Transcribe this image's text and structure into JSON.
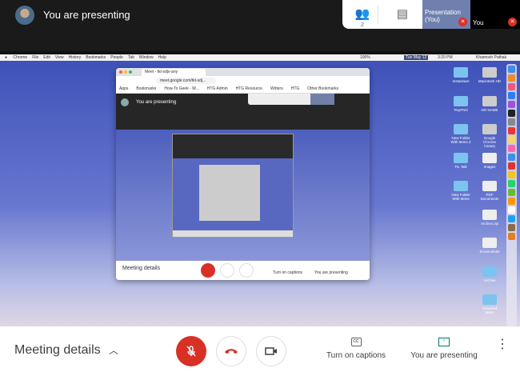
{
  "header": {
    "title": "You are presenting",
    "participant_count": "2"
  },
  "tiles": [
    {
      "label": "Presentation (You)"
    },
    {
      "label": "You"
    }
  ],
  "menubar": {
    "items": [
      "Chrome",
      "File",
      "Edit",
      "View",
      "History",
      "Bookmarks",
      "People",
      "Tab",
      "Window",
      "Help"
    ],
    "date": "Tue May 12",
    "time": "3:20 PM",
    "user": "Khamosh Pathak",
    "battery": "100%"
  },
  "desktop_icons": [
    {
      "label": "Instashare",
      "type": "folder"
    },
    {
      "label": "Macintosh HD",
      "type": "drive"
    },
    {
      "label": "TinyPNG",
      "type": "folder"
    },
    {
      "label": "NO NAME",
      "type": "drive"
    },
    {
      "label": "New Folder With Items 2",
      "type": "folder"
    },
    {
      "label": "Google Chrome Canary",
      "type": "drive"
    },
    {
      "label": "TIL Talk",
      "type": "folder"
    },
    {
      "label": "Images",
      "type": "file"
    },
    {
      "label": "New Folder With Items",
      "type": "folder"
    },
    {
      "label": "PDF Documents",
      "type": "file"
    },
    {
      "label": "Archive.zip",
      "type": "file"
    },
    {
      "label": "Screenshots",
      "type": "file"
    },
    {
      "label": "Archive",
      "type": "folder"
    },
    {
      "label": "Unsorted Items",
      "type": "folder"
    }
  ],
  "dock_colors": [
    "#3d8ee8",
    "#f08a24",
    "#f05a7a",
    "#2e7cf6",
    "#a24fe0",
    "#222",
    "#888",
    "#e33",
    "#f5d66b",
    "#f6a",
    "#3d8ee8",
    "#d33",
    "#f5c518",
    "#25d366",
    "#6b3",
    "#ff9800",
    "#fff",
    "#1da1f2",
    "#8b6b4a",
    "#e67e22"
  ],
  "inner_browser": {
    "tab_title": "Meet - tkt-sdjv-any",
    "url": "meet.google.com/tkt-sdj...",
    "bookmarks": [
      "Apps",
      "Bookmarks",
      "How-To Geek - W...",
      "HTG Admin",
      "HTG Resource",
      "Writers",
      "HTG",
      "Other Bookmarks"
    ],
    "meet_title": "You are presenting",
    "meeting_details": "Meeting details",
    "captions": "Turn on captions",
    "presenting": "You are presenting"
  },
  "bottombar": {
    "meeting_details": "Meeting details",
    "captions": "Turn on captions",
    "presenting": "You are presenting"
  },
  "colors": {
    "accent_red": "#d93025",
    "present_green": "#00796b"
  }
}
